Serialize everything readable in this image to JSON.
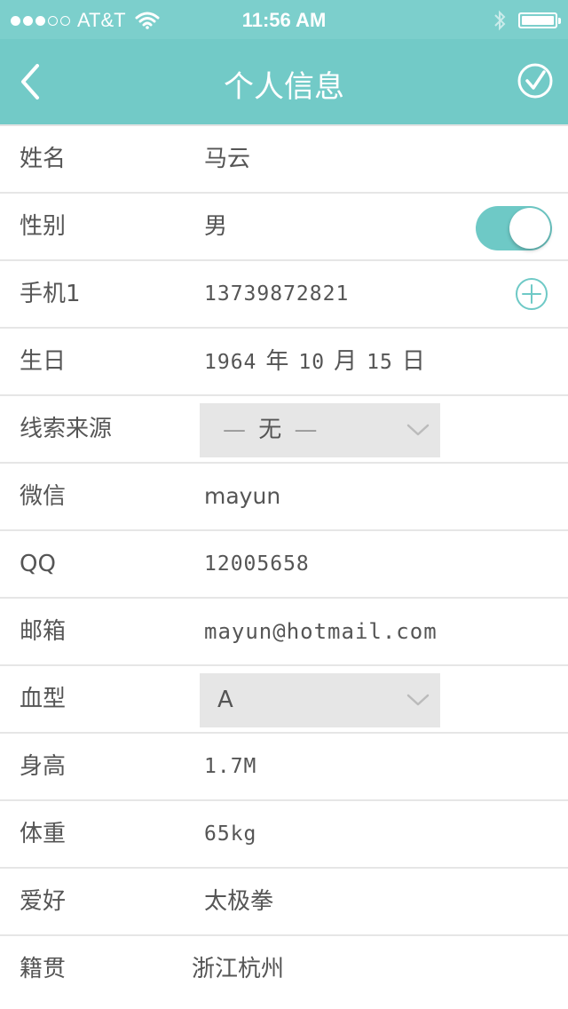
{
  "status_bar": {
    "carrier": "AT&T",
    "time": "11:56 AM",
    "signal_dots_filled": 3,
    "signal_dots_total": 5
  },
  "nav": {
    "title": "个人信息",
    "back_icon": "chevron-left-icon",
    "confirm_icon": "check-circle-icon"
  },
  "form": {
    "name": {
      "label": "姓名",
      "value": "马云"
    },
    "gender": {
      "label": "性别",
      "value": "男",
      "toggle_on": true
    },
    "phone": {
      "label": "手机1",
      "value": "13739872821"
    },
    "birthday": {
      "label": "生日",
      "year": "1964",
      "year_unit": "年",
      "month": "10",
      "month_unit": "月",
      "day": "15",
      "day_unit": "日"
    },
    "source": {
      "label": "线索来源",
      "dash": "—",
      "selected": "无"
    },
    "wechat": {
      "label": "微信",
      "value": "mayun"
    },
    "qq": {
      "label": "QQ",
      "value": "12005658"
    },
    "email": {
      "label": "邮箱",
      "value": "mayun@hotmail.com"
    },
    "blood": {
      "label": "血型",
      "selected": "A"
    },
    "height": {
      "label": "身高",
      "value": "1.7M"
    },
    "weight": {
      "label": "体重",
      "value": "65kg"
    },
    "hobby": {
      "label": "爱好",
      "value": "太极拳"
    },
    "hometown": {
      "label": "籍贯",
      "value": "浙江杭州"
    }
  },
  "colors": {
    "status_bar": "#7ccfcc",
    "nav_bar": "#72cac7",
    "accent": "#6ec9c6",
    "select_bg": "#e6e6e6"
  }
}
